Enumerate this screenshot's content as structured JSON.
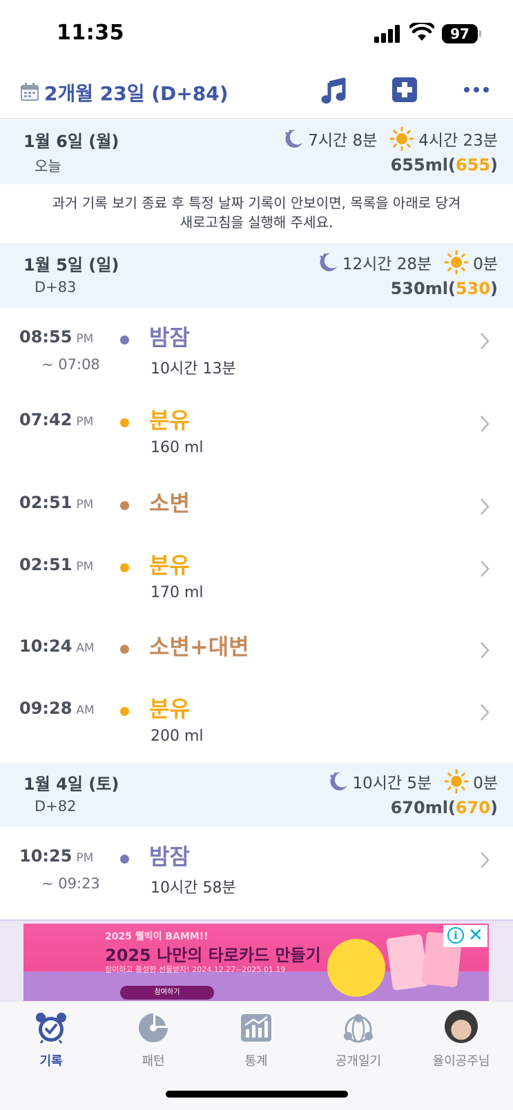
{
  "status_bar": {
    "time": "11:35",
    "battery": "97"
  },
  "header": {
    "title": "2개월 23일 (D+84)"
  },
  "colors": {
    "accent": "#3e57a5",
    "sleep": "#7a7ab8",
    "feeding": "#f5a915",
    "diaper": "#c48a5c",
    "band": "#eef5fa"
  },
  "days": [
    {
      "date": "1월 6일 (월)",
      "sub": "오늘",
      "sleep": "7시간 8분",
      "awake": "4시간 23분",
      "total": "655ml",
      "total_paren": "655"
    },
    {
      "date": "1월 5일 (일)",
      "sub": "D+83",
      "sleep": "12시간 28분",
      "awake": "0분",
      "total": "530ml",
      "total_paren": "530"
    },
    {
      "date": "1월 4일 (토)",
      "sub": "D+82",
      "sleep": "10시간 5분",
      "awake": "0분",
      "total": "670ml",
      "total_paren": "670"
    }
  ],
  "notice": {
    "line1": "과거 기록 보기 종료 후 특정 날짜 기록이 안보이면, 목록을 아래로 당겨",
    "line2": "새로고침을 실행해 주세요."
  },
  "records": [
    {
      "time": "08:55",
      "ampm": "PM",
      "end": "~ 07:08",
      "title": "밤잠",
      "detail": "10시간 13분",
      "kind": "sleep"
    },
    {
      "time": "07:42",
      "ampm": "PM",
      "end": "",
      "title": "분유",
      "detail": "160 ml",
      "kind": "feeding"
    },
    {
      "time": "02:51",
      "ampm": "PM",
      "end": "",
      "title": "소변",
      "detail": "",
      "kind": "diaper"
    },
    {
      "time": "02:51",
      "ampm": "PM",
      "end": "",
      "title": "분유",
      "detail": "170 ml",
      "kind": "feeding"
    },
    {
      "time": "10:24",
      "ampm": "AM",
      "end": "",
      "title": "소변+대변",
      "detail": "",
      "kind": "diaper"
    },
    {
      "time": "09:28",
      "ampm": "AM",
      "end": "",
      "title": "분유",
      "detail": "200 ml",
      "kind": "feeding"
    },
    {
      "time": "10:25",
      "ampm": "PM",
      "end": "~ 09:23",
      "title": "밤잠",
      "detail": "10시간 58분",
      "kind": "sleep"
    }
  ],
  "ad": {
    "line1": "2025 웰빅이 BAMM!!",
    "line2": "2025 나만의 타로카드 만들기",
    "line3": "참여하고 풍성한 선물받자! 2024.12.27~2025.01.19",
    "button": "참여하기",
    "info": "i",
    "close": "✕"
  },
  "tabs": [
    {
      "label": "기록",
      "icon": "alarm-clock-icon",
      "active": true
    },
    {
      "label": "패턴",
      "icon": "pie-chart-icon",
      "active": false
    },
    {
      "label": "통계",
      "icon": "bar-chart-icon",
      "active": false
    },
    {
      "label": "공개일기",
      "icon": "globe-people-icon",
      "active": false
    },
    {
      "label": "율이공주님",
      "icon": "profile-avatar",
      "active": false
    }
  ]
}
